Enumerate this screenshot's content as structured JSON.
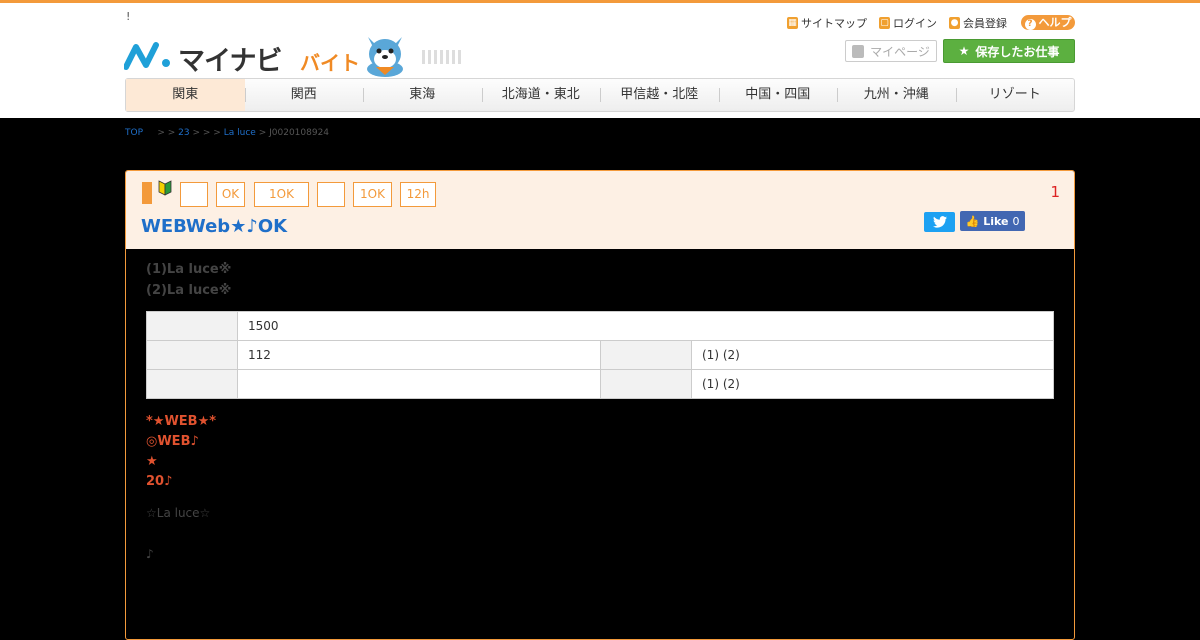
{
  "header": {
    "notice": "!",
    "logo_text": "マイナビ",
    "logo_sub": "バイト",
    "utility": {
      "sitemap": "サイトマップ",
      "login": "ログイン",
      "register": "会員登録",
      "help": "ヘルプ"
    },
    "mypage_label": "マイページ",
    "saved_jobs_label": "保存したお仕事"
  },
  "nav": {
    "items": [
      {
        "label": "関東",
        "active": true
      },
      {
        "label": "関西"
      },
      {
        "label": "東海"
      },
      {
        "label": "北海道・東北"
      },
      {
        "label": "甲信越・北陸"
      },
      {
        "label": "中国・四国"
      },
      {
        "label": "九州・沖縄"
      },
      {
        "label": "リゾート"
      }
    ]
  },
  "breadcrumb": {
    "top": "TOP",
    "sep1": "> >",
    "item2": "23",
    "sep2": "> > >",
    "item3": "La luce",
    "sep3": ">",
    "current": "J0020108924"
  },
  "job": {
    "tags": [
      "",
      "OK",
      "1OK",
      "",
      "1OK",
      "12h"
    ],
    "pr_number": "1",
    "title": "WEBWeb★♪OK",
    "social": {
      "like_label": "Like",
      "like_count": "0"
    },
    "locations": [
      "(1)La luce※",
      "(2)La luce※"
    ],
    "info_table": {
      "row1": {
        "value": "1500"
      },
      "row2": {
        "value": "112",
        "value2": "(1) (2)"
      },
      "row3": {
        "value": "",
        "value2": "(1) (2)"
      }
    },
    "highlights": [
      "*★WEB★*",
      "◎WEB♪",
      "★",
      "20♪"
    ],
    "note1": "☆La luce☆",
    "note2": "♪"
  },
  "colors": {
    "accent_orange": "#f39a3b",
    "link_blue": "#1f6fc9",
    "save_green": "#5cb040",
    "highlight_red": "#e0522f"
  }
}
